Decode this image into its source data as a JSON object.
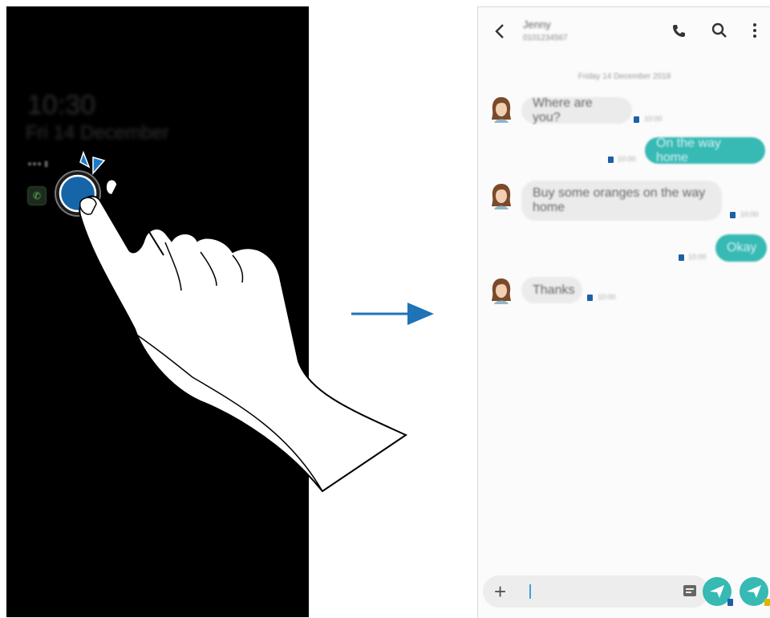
{
  "aod": {
    "time": "10:30",
    "date": "Fri 14 December",
    "status": "●●● ▮"
  },
  "messages_app": {
    "contact": {
      "name": "Jenny",
      "number": "0101234567"
    },
    "date_divider": "Friday 14 December 2018",
    "conversation": [
      {
        "direction": "in",
        "text": "Where are you?",
        "time": "10:00"
      },
      {
        "direction": "out",
        "text": "On the way home",
        "time": "10:00"
      },
      {
        "direction": "in",
        "text": "Buy some oranges on the way home",
        "time": "10:00"
      },
      {
        "direction": "out",
        "text": "Okay",
        "time": "10:00"
      },
      {
        "direction": "in",
        "text": "Thanks",
        "time": "10:00"
      }
    ],
    "sim_badge_colors": {
      "sim1": "#1f5fa8",
      "sim2": "#e0b400"
    },
    "accent_color": "#37b9b4"
  },
  "icons": [
    "back-arrow-icon",
    "phone-icon",
    "search-icon",
    "more-options-icon",
    "add-icon",
    "sticker-icon",
    "send-icon"
  ]
}
